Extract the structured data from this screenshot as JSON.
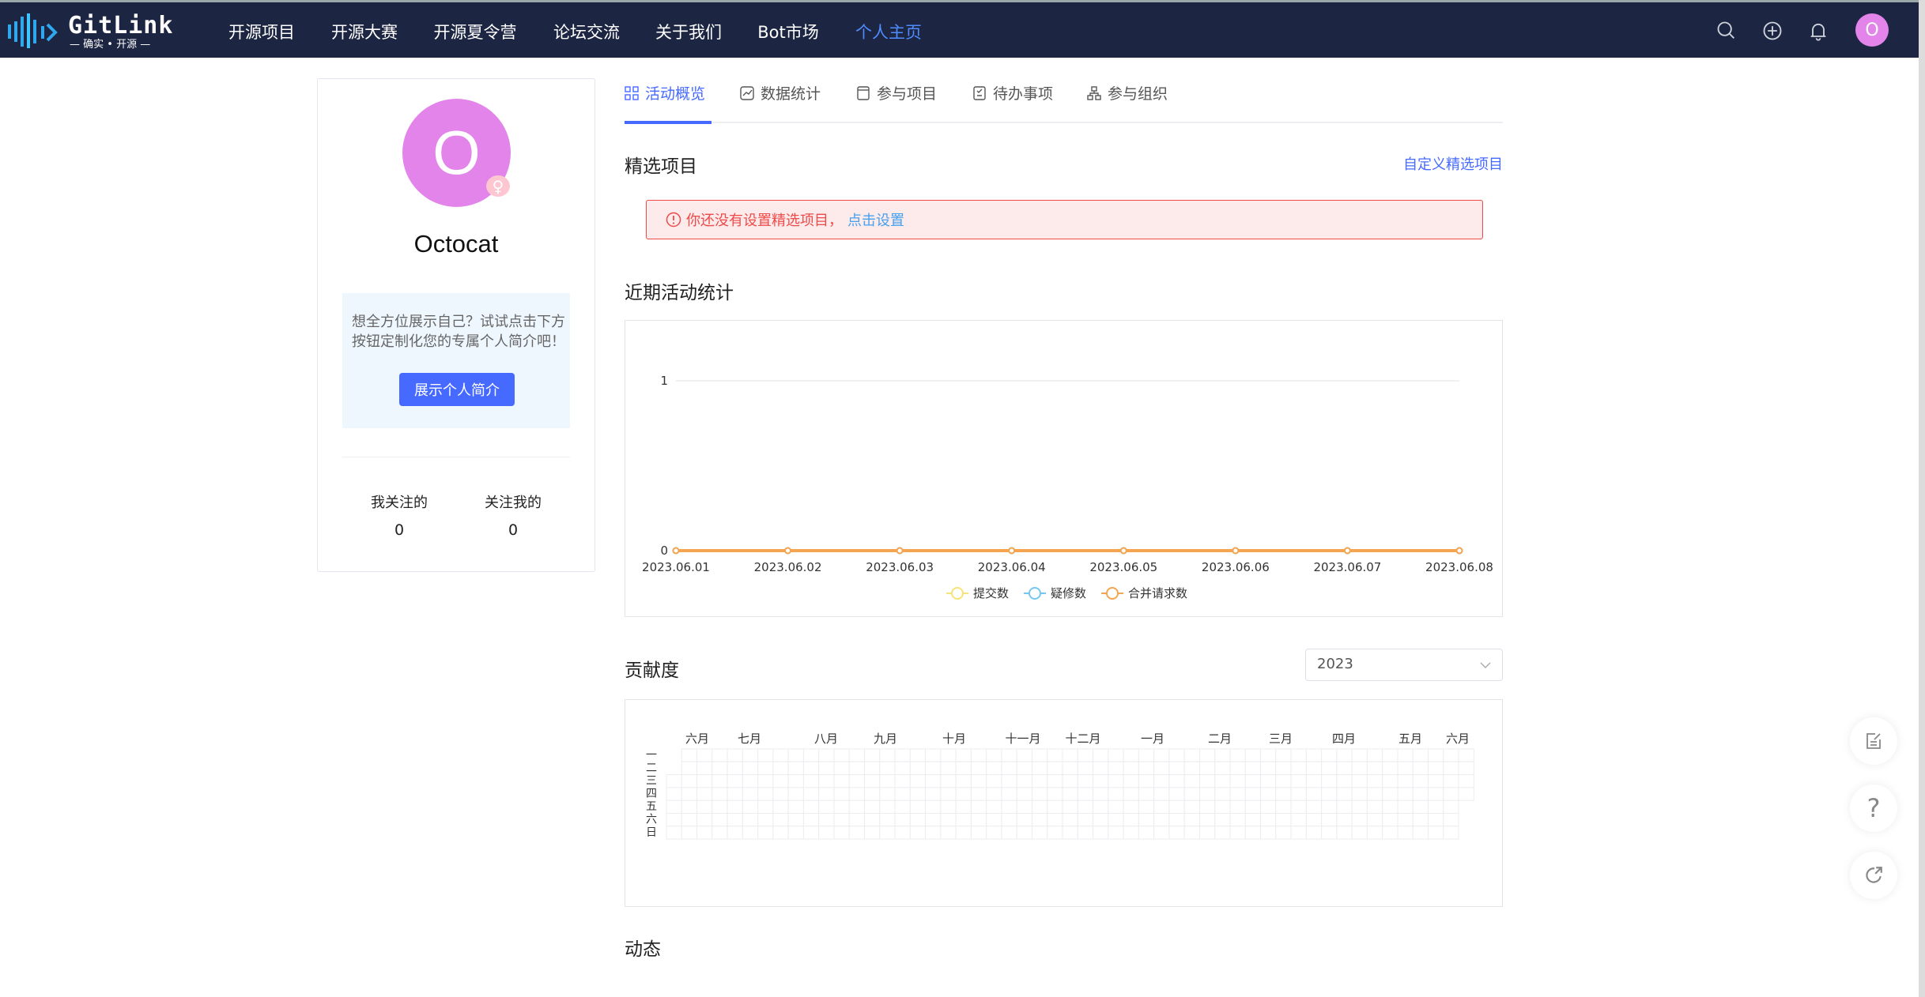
{
  "nav": {
    "logo_text": "GitLink",
    "logo_sub": "确实 • 开源",
    "items": [
      "开源项目",
      "开源大赛",
      "开源夏令营",
      "论坛交流",
      "关于我们",
      "Bot市场",
      "个人主页"
    ],
    "active": "个人主页",
    "avatar_letter": "O",
    "avatar_color": "#e384ea"
  },
  "profile": {
    "avatar_letter": "O",
    "gender_icon": "female-icon",
    "name": "Octocat",
    "intro_text": "想全方位展示自己？试试点击下方按钮定制化您的专属个人简介吧！",
    "intro_button": "展示个人简介",
    "following_label": "我关注的",
    "following_count": "0",
    "followers_label": "关注我的",
    "followers_count": "0"
  },
  "tabs": [
    "活动概览",
    "数据统计",
    "参与项目",
    "待办事项",
    "参与组织"
  ],
  "featured": {
    "title": "精选项目",
    "custom_link": "自定义精选项目",
    "alert_text": "你还没有设置精选项目，",
    "alert_link": "点击设置"
  },
  "activity": {
    "title": "近期活动统计"
  },
  "chart_data": {
    "type": "line",
    "x": [
      "2023.06.01",
      "2023.06.02",
      "2023.06.03",
      "2023.06.04",
      "2023.06.05",
      "2023.06.06",
      "2023.06.07",
      "2023.06.08"
    ],
    "ylim": [
      0,
      1
    ],
    "yticks": [
      "0",
      "1"
    ],
    "legend_position": "bottom",
    "series": [
      {
        "name": "提交数",
        "color": "#f8e27a",
        "values": [
          0,
          0,
          0,
          0,
          0,
          0,
          0,
          0
        ]
      },
      {
        "name": "疑修数",
        "color": "#74c6f3",
        "values": [
          0,
          0,
          0,
          0,
          0,
          0,
          0,
          0
        ]
      },
      {
        "name": "合并请求数",
        "color": "#f5a44f",
        "values": [
          0,
          0,
          0,
          0,
          0,
          0,
          0,
          0
        ]
      }
    ]
  },
  "contribution": {
    "title": "贡献度",
    "year": "2023",
    "months": [
      "六月",
      "七月",
      "八月",
      "九月",
      "十月",
      "十一月",
      "十二月",
      "一月",
      "二月",
      "三月",
      "四月",
      "五月",
      "六月"
    ],
    "weekdays": [
      "一",
      "二",
      "三",
      "四",
      "五",
      "六",
      "日"
    ]
  },
  "feed": {
    "title": "动态"
  },
  "colors": {
    "accent": "#466aff",
    "nav_bg": "#1c2541",
    "alert": "#ef4a4a"
  }
}
